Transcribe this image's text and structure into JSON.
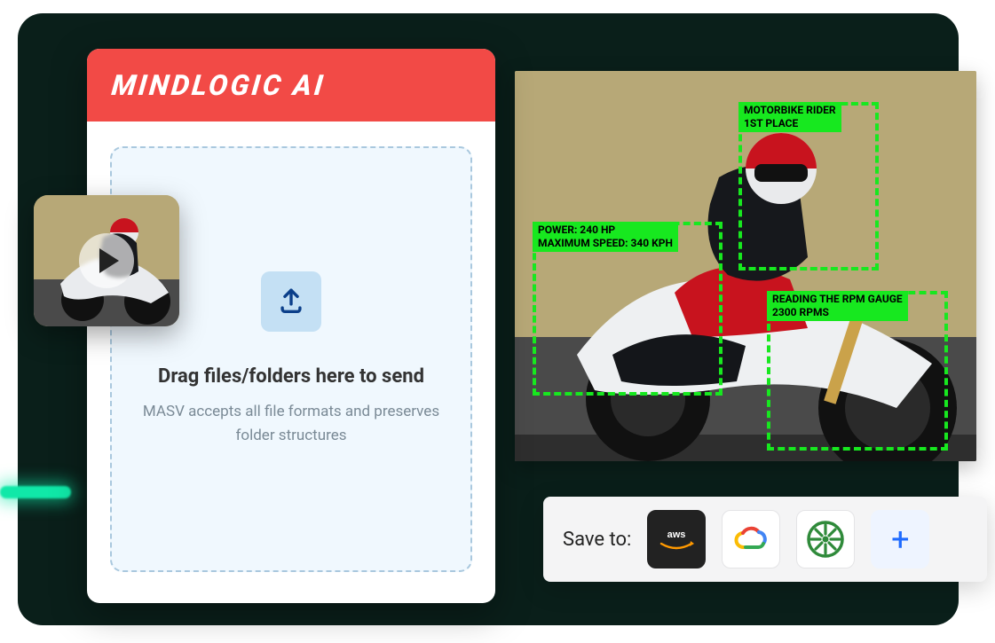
{
  "brand": {
    "title": "MINDLOGIC AI"
  },
  "dropzone": {
    "title": "Drag files/folders here to send",
    "subtitle": "MASV accepts all file formats and preserves folder structures"
  },
  "detections": [
    {
      "id": "rider",
      "label": "MOTORBIKE RIDER\n1ST PLACE"
    },
    {
      "id": "power",
      "label": "POWER: 240 HP\nMAXIMUM SPEED: 340 KPH"
    },
    {
      "id": "rpm",
      "label": "READING THE RPM GAUGE\n2300 RPMS"
    }
  ],
  "saveBar": {
    "label": "Save to:",
    "providers": [
      {
        "name": "aws",
        "label": "AWS"
      },
      {
        "name": "google-cloud",
        "label": "Google Cloud"
      },
      {
        "name": "wasabi",
        "label": "Wasabi"
      }
    ]
  },
  "icons": {
    "upload": "upload-icon",
    "play": "play-icon",
    "plus": "plus-icon"
  }
}
